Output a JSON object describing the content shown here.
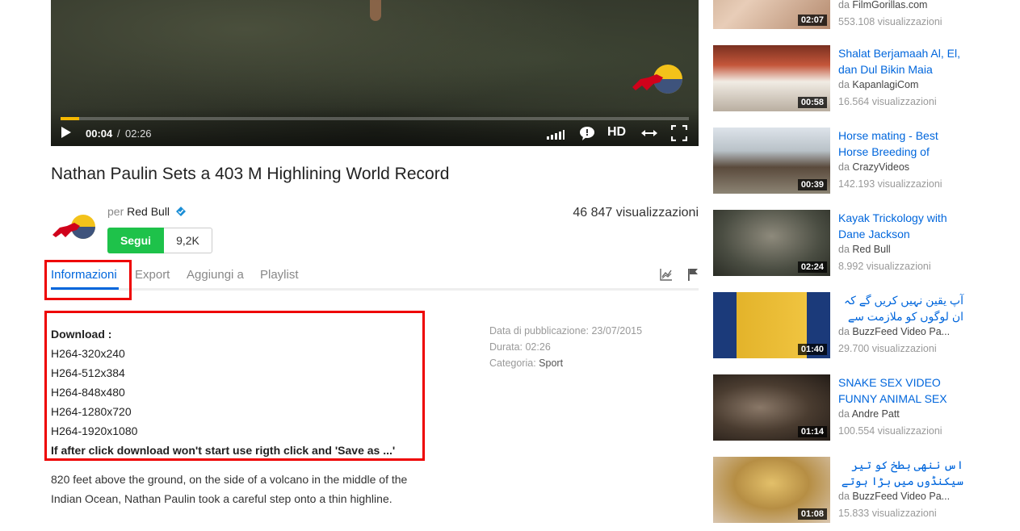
{
  "player": {
    "time_current": "00:04",
    "time_separator": "/",
    "time_total": "02:26",
    "progress_fraction": 0.03,
    "hd_label": "HD",
    "accent_color": "#f5b800"
  },
  "video": {
    "title": "Nathan Paulin Sets a 403 M Highlining World Record",
    "per_label": "per",
    "channel_name": "Red Bull",
    "views": "46 847 visualizzazioni",
    "follow_label": "Segui",
    "followers": "9,2K"
  },
  "tabs": [
    {
      "label": "Informazioni",
      "active": true
    },
    {
      "label": "Export"
    },
    {
      "label": "Aggiungi a"
    },
    {
      "label": "Playlist"
    }
  ],
  "download": {
    "heading": "Download :",
    "formats": [
      "H264-320x240",
      "H264-512x384",
      "H264-848x480",
      "H264-1280x720",
      "H264-1920x1080"
    ],
    "note": "If after click download won't start use rigth click and 'Save as ...'"
  },
  "description": "820 feet above the ground, on the side of a volcano in the middle of the Indian Ocean, Nathan Paulin took a careful step onto a thin highline.",
  "meta": {
    "published_label": "Data di pubblicazione:",
    "published_value": "23/07/2015",
    "duration_label": "Durata:",
    "duration_value": "02:26",
    "category_label": "Categoria:",
    "category_value": "Sport"
  },
  "related": [
    {
      "title": "",
      "by": "da",
      "author": "FilmGorillas.com",
      "views": "553.108 visualizzazioni",
      "duration": "02:07"
    },
    {
      "title": "Shalat Berjamaah Al, El, dan Dul Bikin Maia",
      "by": "da",
      "author": "KapanlagiCom",
      "views": "16.564 visualizzazioni",
      "duration": "00:58"
    },
    {
      "title": "Horse mating - Best Horse Breeding of",
      "by": "da",
      "author": "CrazyVideos",
      "views": "142.193 visualizzazioni",
      "duration": "00:39"
    },
    {
      "title": "Kayak Trickology with Dane Jackson",
      "by": "da",
      "author": "Red Bull",
      "views": "8.992 visualizzazioni",
      "duration": "02:24"
    },
    {
      "title": "آپ یقین نہیں کریں گے کہ ان لوگوں کو ملازمت سے",
      "by": "da",
      "author": "BuzzFeed Video Pa...",
      "views": "29.700 visualizzazioni",
      "duration": "01:40"
    },
    {
      "title": "SNAKE SEX VIDEO FUNNY ANIMAL SEX",
      "by": "da",
      "author": "Andre Patt",
      "views": "100.554 visualizzazioni",
      "duration": "01:14"
    },
    {
      "title": "اس ننھی بطخ کو تیر سیکنڈوں میں بڑا ہوتے",
      "by": "da",
      "author": "BuzzFeed Video Pa...",
      "views": "15.833 visualizzazioni",
      "duration": "01:08"
    }
  ]
}
